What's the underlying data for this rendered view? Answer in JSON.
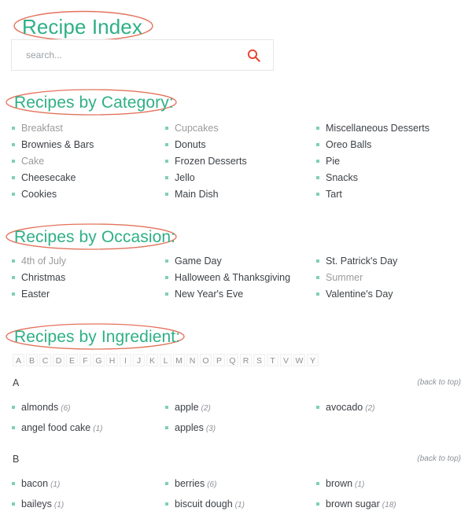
{
  "page": {
    "title": "Recipe Index",
    "background": "#ffffff",
    "accent_teal": "#2eb086",
    "accent_coral": "#e2735c",
    "bullet_color": "#7fd0b5",
    "text_color": "#3d4146",
    "muted_color": "#9b9b9b"
  },
  "search": {
    "placeholder": "search...",
    "value": "",
    "icon": "search-icon"
  },
  "sections": {
    "category": {
      "heading": "Recipes by Category:",
      "columns": [
        [
          {
            "label": "Breakfast",
            "muted": true
          },
          {
            "label": "Brownies & Bars",
            "muted": false
          },
          {
            "label": "Cake",
            "muted": true
          },
          {
            "label": "Cheesecake",
            "muted": false
          },
          {
            "label": "Cookies",
            "muted": false
          }
        ],
        [
          {
            "label": "Cupcakes",
            "muted": true
          },
          {
            "label": "Donuts",
            "muted": false
          },
          {
            "label": "Frozen Desserts",
            "muted": false
          },
          {
            "label": "Jello",
            "muted": false
          },
          {
            "label": "Main Dish",
            "muted": false
          }
        ],
        [
          {
            "label": "Miscellaneous Desserts",
            "muted": false
          },
          {
            "label": "Oreo Balls",
            "muted": false
          },
          {
            "label": "Pie",
            "muted": false
          },
          {
            "label": "Snacks",
            "muted": false
          },
          {
            "label": "Tart",
            "muted": false
          }
        ]
      ]
    },
    "occasion": {
      "heading": "Recipes by Occasion:",
      "columns": [
        [
          {
            "label": "4th of July",
            "muted": true
          },
          {
            "label": "Christmas",
            "muted": false
          },
          {
            "label": "Easter",
            "muted": false
          }
        ],
        [
          {
            "label": "Game Day",
            "muted": false
          },
          {
            "label": "Halloween & Thanksgiving",
            "muted": false
          },
          {
            "label": "New Year's Eve",
            "muted": false
          }
        ],
        [
          {
            "label": "St. Patrick's Day",
            "muted": false
          },
          {
            "label": "Summer",
            "muted": true
          },
          {
            "label": "Valentine's Day",
            "muted": false
          }
        ]
      ]
    },
    "ingredient": {
      "heading": "Recipes by Ingredient:",
      "alphabet": [
        "A",
        "B",
        "C",
        "D",
        "E",
        "F",
        "G",
        "H",
        "I",
        "J",
        "K",
        "L",
        "M",
        "N",
        "O",
        "P",
        "Q",
        "R",
        "S",
        "T",
        "V",
        "W",
        "Y"
      ],
      "back_to_top_label": "(back to top)",
      "groups": [
        {
          "letter": "A",
          "columns": [
            [
              {
                "label": "almonds",
                "count": "(6)"
              },
              {
                "label": "angel food cake",
                "count": "(1)"
              }
            ],
            [
              {
                "label": "apple",
                "count": "(2)"
              },
              {
                "label": "apples",
                "count": "(3)"
              }
            ],
            [
              {
                "label": "avocado",
                "count": "(2)"
              }
            ]
          ]
        },
        {
          "letter": "B",
          "columns": [
            [
              {
                "label": "bacon",
                "count": "(1)"
              },
              {
                "label": "baileys",
                "count": "(1)"
              }
            ],
            [
              {
                "label": "berries",
                "count": "(6)"
              },
              {
                "label": "biscuit dough",
                "count": "(1)"
              }
            ],
            [
              {
                "label": "brown",
                "count": "(1)"
              },
              {
                "label": "brown sugar",
                "count": "(18)"
              }
            ]
          ]
        }
      ]
    }
  }
}
